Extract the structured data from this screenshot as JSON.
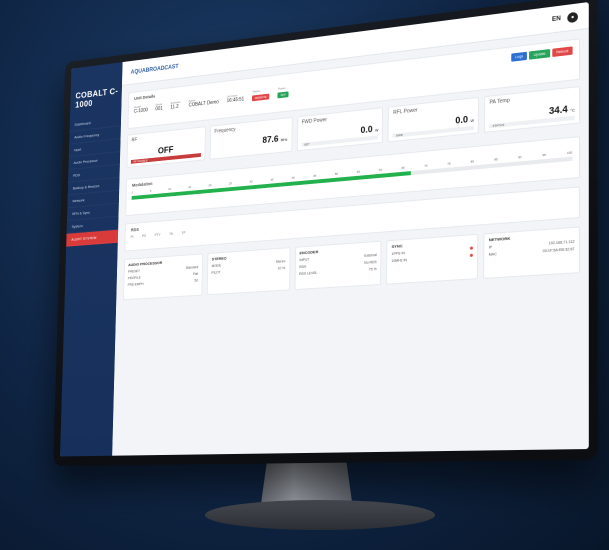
{
  "brand": "COBALT C-1000",
  "header": {
    "breadcrumb": "AQUABROADCAST",
    "lang": "EN"
  },
  "sidebar": {
    "items": [
      {
        "label": "Dashboard"
      },
      {
        "label": "Audio Frequency"
      },
      {
        "label": "Input"
      },
      {
        "label": "Audio Processor"
      },
      {
        "label": "RDS"
      },
      {
        "label": "Backup & Restore"
      },
      {
        "label": "Network"
      },
      {
        "label": "SFN & Sync"
      },
      {
        "label": "System"
      },
      {
        "label": "ALERT SYSTEM"
      }
    ]
  },
  "unit": {
    "title": "Unit Details",
    "cells": [
      {
        "label": "Model",
        "value": "C-1000"
      },
      {
        "label": "Serial",
        "value": "001"
      },
      {
        "label": "Software",
        "value": "11.2"
      },
      {
        "label": "Name",
        "value": "COBALT Demo"
      },
      {
        "label": "Unit time",
        "value": "16:45:51"
      }
    ],
    "status_label": "Status",
    "status_value": "REMOTE",
    "power_label": "Power",
    "power_value": "OFF",
    "quick_label": "Quick Actions",
    "buttons": [
      "Logs",
      "Update",
      "Reboot"
    ]
  },
  "cards": [
    {
      "title": "RF",
      "value": "OFF",
      "unit": "",
      "bar": "RF ENABLE",
      "bar_red": true
    },
    {
      "title": "Frequency",
      "value": "87.6",
      "unit": "MHz",
      "bar": "",
      "bar_red": false
    },
    {
      "title": "FWD Power",
      "value": "0.0",
      "unit": "W",
      "bar": "SET",
      "bar_red": false
    },
    {
      "title": "RFL Power",
      "value": "0.0",
      "unit": "W",
      "bar": "SWR",
      "bar_red": false
    },
    {
      "title": "PA Temp",
      "value": "34.4",
      "unit": "°C",
      "bar": "STATUS",
      "bar_red": false
    }
  ],
  "modulation": {
    "title": "Modulation",
    "scale": [
      "0",
      "5",
      "10",
      "15",
      "20",
      "25",
      "30",
      "35",
      "40",
      "45",
      "50",
      "55",
      "60",
      "65",
      "70",
      "75",
      "80",
      "85",
      "90",
      "95",
      "100"
    ],
    "level": 0.66
  },
  "rds": {
    "title": "RDS",
    "fields": [
      "PI",
      "PS",
      "PTY",
      "TA",
      "TP"
    ]
  },
  "bottom": [
    {
      "title": "AUDIO PROCESSOR",
      "rows": [
        [
          "PRESET",
          "Standard"
        ],
        [
          "PROFILE",
          "Flat"
        ],
        [
          "PRE-EMPH",
          "50"
        ]
      ]
    },
    {
      "title": "STEREO",
      "rows": [
        [
          "MODE",
          "Stereo"
        ],
        [
          "PILOT",
          "10 %"
        ]
      ]
    },
    {
      "title": "ENCODER",
      "rows": [
        [
          "INPUT",
          "External"
        ],
        [
          "RDS",
          "No RDS"
        ],
        [
          "RDS LEVEL",
          "75 %"
        ]
      ]
    },
    {
      "title": "SYNC",
      "rows": [
        [
          "1PPS IN",
          ""
        ],
        [
          "10MHz IN",
          ""
        ]
      ]
    },
    {
      "title": "NETWORK",
      "rows": [
        [
          "IP",
          "192.168.71.112"
        ],
        [
          "MAC",
          "00:1F:5A:EB:32:67"
        ]
      ]
    }
  ]
}
